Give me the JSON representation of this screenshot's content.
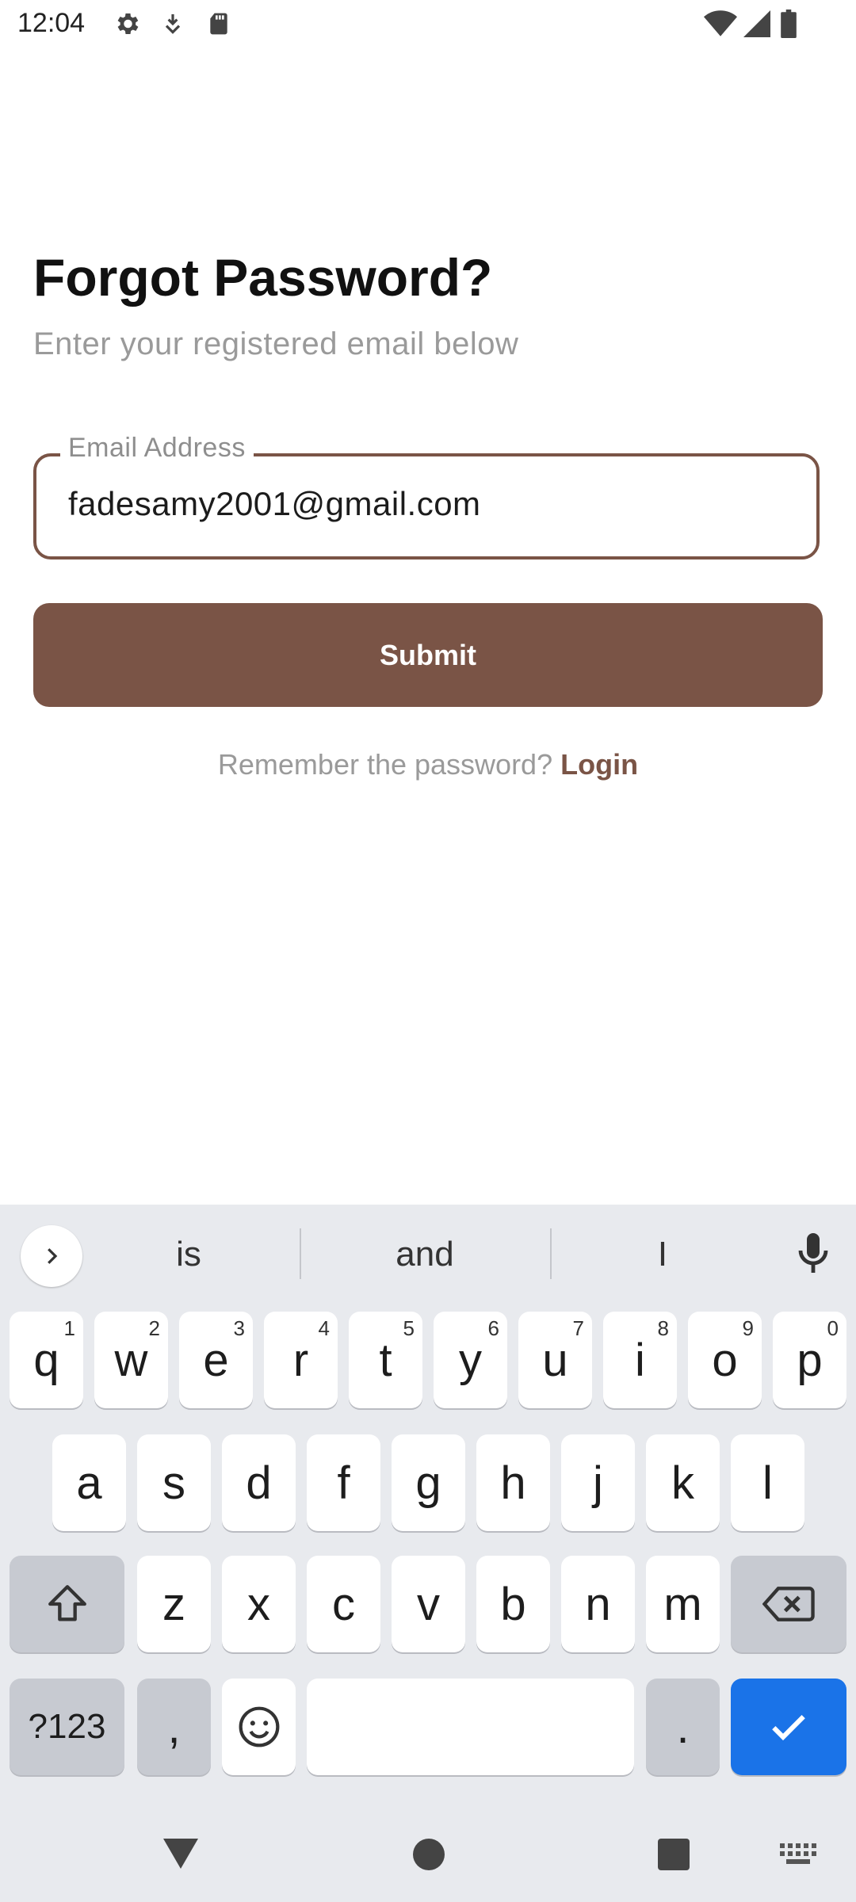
{
  "status_bar": {
    "time": "12:04",
    "icons_left": [
      "settings-gear-icon",
      "download-icon",
      "sd-card-icon"
    ],
    "icons_right": [
      "wifi-icon",
      "cell-signal-icon",
      "battery-icon"
    ]
  },
  "page": {
    "title": "Forgot Password?",
    "subtitle": "Enter your registered email below",
    "email_field": {
      "label": "Email Address",
      "value": "fadesamy2001@gmail.com"
    },
    "submit_label": "Submit",
    "remember_text": "Remember the password? ",
    "login_link": "Login"
  },
  "colors": {
    "accent": "#7a5446",
    "keyboard_bg": "#e8eaee",
    "enter_key": "#1a73e8"
  },
  "keyboard": {
    "suggestions": [
      "is",
      "and",
      "I"
    ],
    "row1": [
      {
        "key": "q",
        "hint": "1"
      },
      {
        "key": "w",
        "hint": "2"
      },
      {
        "key": "e",
        "hint": "3"
      },
      {
        "key": "r",
        "hint": "4"
      },
      {
        "key": "t",
        "hint": "5"
      },
      {
        "key": "y",
        "hint": "6"
      },
      {
        "key": "u",
        "hint": "7"
      },
      {
        "key": "i",
        "hint": "8"
      },
      {
        "key": "o",
        "hint": "9"
      },
      {
        "key": "p",
        "hint": "0"
      }
    ],
    "row2": [
      "a",
      "s",
      "d",
      "f",
      "g",
      "h",
      "j",
      "k",
      "l"
    ],
    "row3": [
      "z",
      "x",
      "c",
      "v",
      "b",
      "n",
      "m"
    ],
    "symbols_label": "?123",
    "comma": ",",
    "period": "."
  },
  "nav_bar": {
    "icons": [
      "back-triangle-icon",
      "home-circle-icon",
      "recents-square-icon",
      "keyboard-switch-icon"
    ]
  }
}
